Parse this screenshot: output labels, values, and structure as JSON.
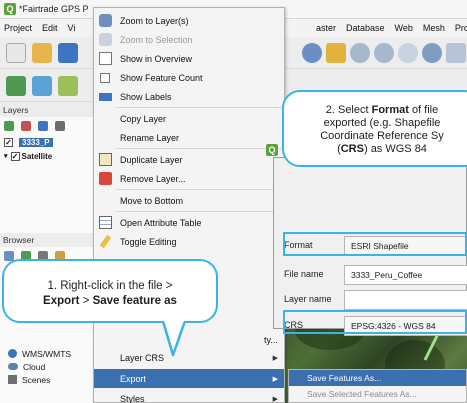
{
  "window": {
    "title": "*Fairtrade GPS P",
    "menubar_left": [
      "Project",
      "Edit",
      "Vi"
    ],
    "menubar_right": [
      "aster",
      "Database",
      "Web",
      "Mesh",
      "Proces"
    ]
  },
  "layers_panel": {
    "title": "Layers",
    "rows": [
      {
        "label": "3333_P",
        "selected": true
      },
      {
        "label": "Satellite",
        "selected": false
      }
    ]
  },
  "browser_panel": {
    "title": "Browser",
    "items": [
      "WMS/WMTS",
      "Cloud",
      "Scenes"
    ]
  },
  "context_menu": {
    "items": [
      {
        "label": "Zoom to Layer(s)",
        "icon": "zoom-layer-icon",
        "enabled": true
      },
      {
        "label": "Zoom to Selection",
        "icon": "zoom-selection-icon",
        "enabled": false
      },
      {
        "label": "Show in Overview",
        "icon": "overview-icon",
        "enabled": true
      },
      {
        "label": "Show Feature Count",
        "icon": "checkbox-icon",
        "enabled": true
      },
      {
        "label": "Show Labels",
        "icon": "labels-icon",
        "enabled": true
      },
      {
        "label": "Copy Layer",
        "icon": "",
        "enabled": true
      },
      {
        "label": "Rename Layer",
        "icon": "",
        "enabled": true
      },
      {
        "label": "Duplicate Layer",
        "icon": "duplicate-icon",
        "enabled": true
      },
      {
        "label": "Remove Layer...",
        "icon": "remove-icon",
        "enabled": true
      },
      {
        "label": "Move to Bottom",
        "icon": "",
        "enabled": true
      },
      {
        "label": "Open Attribute Table",
        "icon": "table-icon",
        "enabled": true
      },
      {
        "label": "Toggle Editing",
        "icon": "pencil-icon",
        "enabled": true
      },
      {
        "label": "ty...",
        "icon": "",
        "enabled": true
      },
      {
        "label": "Layer CRS",
        "icon": "",
        "enabled": true
      },
      {
        "label": "Export",
        "icon": "",
        "enabled": true
      },
      {
        "label": "Styles",
        "icon": "",
        "enabled": true
      }
    ]
  },
  "export_submenu": {
    "items": [
      "Save Features As...",
      "Save Selected Features As..."
    ]
  },
  "export_dialog": {
    "format_label": "Format",
    "format_value": "ESRI Shapefile",
    "filename_label": "File name",
    "filename_value": "3333_Peru_Coffee",
    "layername_label": "Layer name",
    "layername_value": "",
    "crs_label": "CRS",
    "crs_value": "EPSG:4326 - WGS 84"
  },
  "callouts": {
    "step1_prefix": "1. Right-click in the file >",
    "step1_bold1": "Export",
    "step1_sep": " > ",
    "step1_bold2": "Save feature as",
    "step2_a": "2. Select ",
    "step2_bold1": "Format",
    "step2_b": " of file",
    "step2_line2": "exported (e.g. Shapefile",
    "step2_line3": "Coordinate Reference Sy",
    "step2_l4a": "(",
    "step2_bold2": "CRS",
    "step2_l4b": ") as WGS 84"
  },
  "colors": {
    "accent": "#3bb3e6",
    "selection": "#3a6fb0"
  }
}
